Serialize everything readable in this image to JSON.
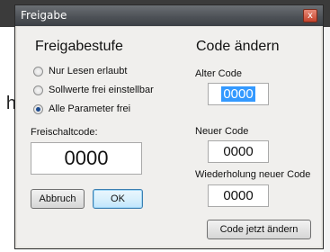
{
  "window": {
    "title": "Freigabe",
    "close_symbol": "x"
  },
  "background": {
    "fragment_text": "h"
  },
  "left": {
    "heading": "Freigabestufe",
    "options": [
      {
        "label": "Nur Lesen erlaubt",
        "selected": false
      },
      {
        "label": "Sollwerte frei einstellbar",
        "selected": false
      },
      {
        "label": "Alle Parameter frei",
        "selected": true
      }
    ],
    "code_label": "Freischaltcode:",
    "code_value": "0000",
    "cancel_label": "Abbruch",
    "ok_label": "OK"
  },
  "right": {
    "heading": "Code ändern",
    "old_label": "Alter Code",
    "old_value": "0000",
    "new_label": "Neuer Code",
    "new_value": "0000",
    "repeat_label": "Wiederholung neuer Code",
    "repeat_value": "0000",
    "change_label": "Code jetzt ändern"
  },
  "colors": {
    "selection": "#3399ff",
    "titlebar": "#4e5257",
    "close": "#c5432b"
  }
}
